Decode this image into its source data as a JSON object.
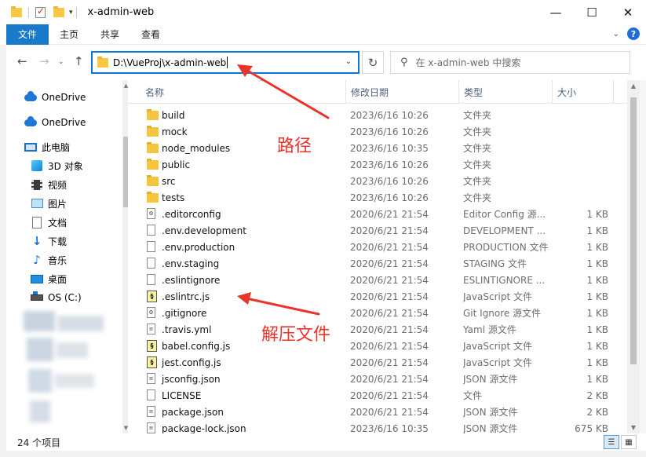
{
  "window": {
    "title": "x-admin-web",
    "controls": {
      "minimize": "—",
      "maximize": "☐",
      "close": "✕"
    }
  },
  "ribbon": {
    "tabs": [
      {
        "label": "文件"
      },
      {
        "label": "主页"
      },
      {
        "label": "共享"
      },
      {
        "label": "查看"
      }
    ],
    "help": "?"
  },
  "address": {
    "path": "D:\\VueProj\\x-admin-web"
  },
  "search": {
    "placeholder": "在 x-admin-web 中搜索"
  },
  "nav_pane": {
    "items": [
      {
        "label": "OneDrive",
        "icon": "cloud-icon"
      },
      {
        "label": "OneDrive",
        "icon": "cloud-icon"
      },
      {
        "label": "此电脑",
        "icon": "computer-icon"
      },
      {
        "label": "3D 对象",
        "icon": "cube-icon"
      },
      {
        "label": "视频",
        "icon": "film-icon"
      },
      {
        "label": "图片",
        "icon": "picture-icon"
      },
      {
        "label": "文档",
        "icon": "document-icon"
      },
      {
        "label": "下载",
        "icon": "download-icon"
      },
      {
        "label": "音乐",
        "icon": "music-icon"
      },
      {
        "label": "桌面",
        "icon": "desktop-icon"
      },
      {
        "label": "OS (C:)",
        "icon": "disk-icon"
      }
    ]
  },
  "file_list": {
    "columns": {
      "name": "名称",
      "date": "修改日期",
      "type": "类型",
      "size": "大小"
    },
    "rows": [
      {
        "name": "build",
        "date": "2023/6/16 10:26",
        "type": "文件夹",
        "size": "",
        "icon": "folder-icon"
      },
      {
        "name": "mock",
        "date": "2023/6/16 10:26",
        "type": "文件夹",
        "size": "",
        "icon": "folder-icon"
      },
      {
        "name": "node_modules",
        "date": "2023/6/16 10:35",
        "type": "文件夹",
        "size": "",
        "icon": "folder-icon"
      },
      {
        "name": "public",
        "date": "2023/6/16 10:26",
        "type": "文件夹",
        "size": "",
        "icon": "folder-icon"
      },
      {
        "name": "src",
        "date": "2023/6/16 10:26",
        "type": "文件夹",
        "size": "",
        "icon": "folder-icon"
      },
      {
        "name": "tests",
        "date": "2023/6/16 10:26",
        "type": "文件夹",
        "size": "",
        "icon": "folder-icon"
      },
      {
        "name": ".editorconfig",
        "date": "2020/6/21 21:54",
        "type": "Editor Config 源...",
        "size": "1 KB",
        "icon": "settings-file-icon"
      },
      {
        "name": ".env.development",
        "date": "2020/6/21 21:54",
        "type": "DEVELOPMENT ...",
        "size": "1 KB",
        "icon": "file-icon"
      },
      {
        "name": ".env.production",
        "date": "2020/6/21 21:54",
        "type": "PRODUCTION 文件",
        "size": "1 KB",
        "icon": "file-icon"
      },
      {
        "name": ".env.staging",
        "date": "2020/6/21 21:54",
        "type": "STAGING 文件",
        "size": "1 KB",
        "icon": "file-icon"
      },
      {
        "name": ".eslintignore",
        "date": "2020/6/21 21:54",
        "type": "ESLINTIGNORE ...",
        "size": "1 KB",
        "icon": "file-icon"
      },
      {
        "name": ".eslintrc.js",
        "date": "2020/6/21 21:54",
        "type": "JavaScript 文件",
        "size": "1 KB",
        "icon": "javascript-file-icon"
      },
      {
        "name": ".gitignore",
        "date": "2020/6/21 21:54",
        "type": "Git Ignore 源文件",
        "size": "1 KB",
        "icon": "settings-file-icon"
      },
      {
        "name": ".travis.yml",
        "date": "2020/6/21 21:54",
        "type": "Yaml 源文件",
        "size": "1 KB",
        "icon": "text-file-icon"
      },
      {
        "name": "babel.config.js",
        "date": "2020/6/21 21:54",
        "type": "JavaScript 文件",
        "size": "1 KB",
        "icon": "javascript-file-icon"
      },
      {
        "name": "jest.config.js",
        "date": "2020/6/21 21:54",
        "type": "JavaScript 文件",
        "size": "1 KB",
        "icon": "javascript-file-icon"
      },
      {
        "name": "jsconfig.json",
        "date": "2020/6/21 21:54",
        "type": "JSON 源文件",
        "size": "1 KB",
        "icon": "text-file-icon"
      },
      {
        "name": "LICENSE",
        "date": "2020/6/21 21:54",
        "type": "文件",
        "size": "2 KB",
        "icon": "file-icon"
      },
      {
        "name": "package.json",
        "date": "2020/6/21 21:54",
        "type": "JSON 源文件",
        "size": "2 KB",
        "icon": "text-file-icon"
      },
      {
        "name": "package-lock.json",
        "date": "2023/6/16 10:35",
        "type": "JSON 源文件",
        "size": "675 KB",
        "icon": "text-file-icon"
      }
    ]
  },
  "status": {
    "count": "24 个项目"
  },
  "annotations": {
    "path_label": "路径",
    "unzip_label": "解压文件",
    "color": "#e8342b"
  },
  "colors": {
    "accent": "#1979ca",
    "folder": "#f6c540"
  }
}
